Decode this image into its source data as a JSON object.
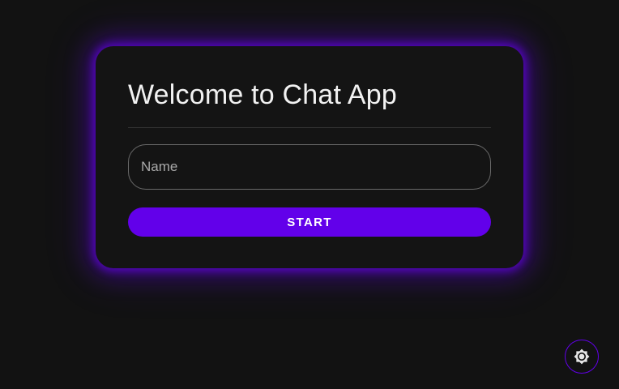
{
  "welcome": {
    "title": "Welcome to Chat App",
    "name_placeholder": "Name",
    "name_value": "",
    "start_label": "START"
  },
  "theme_toggle": {
    "icon": "brightness-icon"
  },
  "colors": {
    "background": "#121212",
    "card": "#141414",
    "accent": "#6200ea",
    "text": "#f2f2f2",
    "placeholder": "#a9a9a9"
  }
}
